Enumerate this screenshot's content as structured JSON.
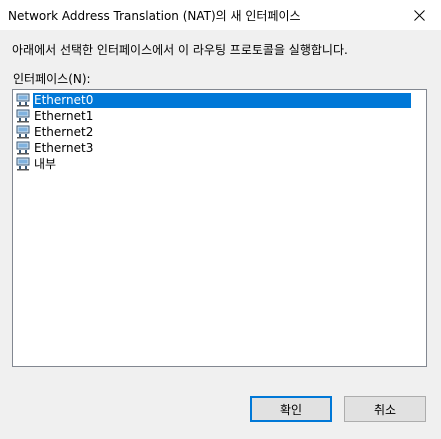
{
  "window": {
    "title": "Network Address Translation (NAT)의 새 인터페이스",
    "close_glyph": "✕"
  },
  "main": {
    "description": "아래에서 선택한 인터페이스에서 이 라우팅 프로토콜을 실행합니다.",
    "list_label": "인터페이스(N):",
    "interfaces": [
      {
        "label": "Ethernet0",
        "selected": true,
        "icon": "network-adapter-icon"
      },
      {
        "label": "Ethernet1",
        "selected": false,
        "icon": "network-adapter-icon"
      },
      {
        "label": "Ethernet2",
        "selected": false,
        "icon": "network-adapter-icon"
      },
      {
        "label": "Ethernet3",
        "selected": false,
        "icon": "network-adapter-icon"
      },
      {
        "label": "내부",
        "selected": false,
        "icon": "network-adapter-icon"
      }
    ]
  },
  "buttons": {
    "ok_label": "확인",
    "cancel_label": "취소"
  },
  "colors": {
    "selection": "#0078d7",
    "window_bg": "#f0f0f0",
    "button_bg": "#e1e1e1"
  }
}
